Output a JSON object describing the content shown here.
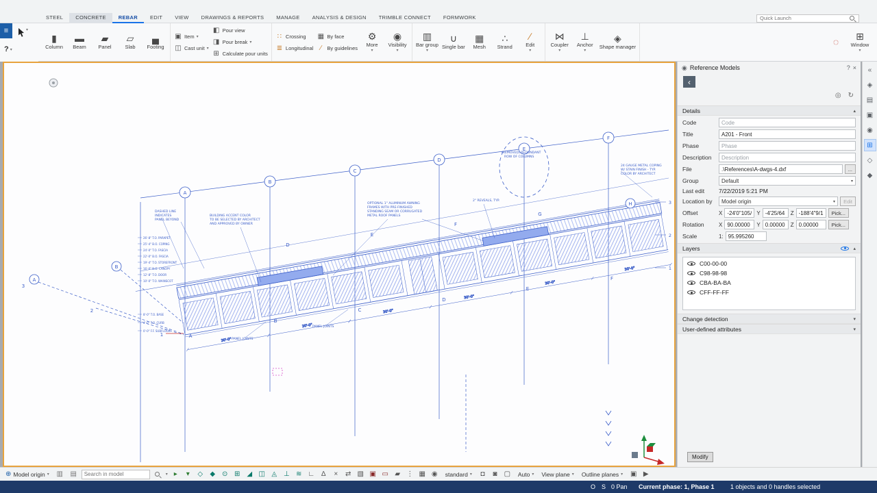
{
  "colors": {
    "accent": "#1a73e8",
    "viewport_border": "#e8a33d",
    "drawing_blue": "#3a5dc8",
    "status_bar_bg": "#1e3a68",
    "canopy_fill": "#93abee"
  },
  "titlebar": {
    "quick_launch_placeholder": "Quick Launch"
  },
  "tabs": [
    {
      "label": "STEEL"
    },
    {
      "label": "CONCRETE",
      "highlight": true
    },
    {
      "label": "REBAR",
      "active": true
    },
    {
      "label": "EDIT"
    },
    {
      "label": "VIEW"
    },
    {
      "label": "DRAWINGS & REPORTS"
    },
    {
      "label": "MANAGE"
    },
    {
      "label": "ANALYSIS & DESIGN"
    },
    {
      "label": "TRIMBLE CONNECT"
    },
    {
      "label": "FORMWORK"
    }
  ],
  "ribbon": {
    "column": "Column",
    "beam": "Beam",
    "panel": "Panel",
    "slab": "Slab",
    "footing": "Footing",
    "item": "Item",
    "cast_unit": "Cast unit",
    "pour_view": "Pour view",
    "pour_break": "Pour break",
    "calculate_pour_units": "Calculate pour units",
    "crossing": "Crossing",
    "longitudinal": "Longitudinal",
    "by_face": "By face",
    "by_guidelines": "By guidelines",
    "more": "More",
    "visibility": "Visibility",
    "bar_group": "Bar group",
    "single_bar": "Single bar",
    "mesh": "Mesh",
    "strand": "Strand",
    "edit": "Edit",
    "coupler": "Coupler",
    "anchor": "Anchor",
    "shape_manager": "Shape manager",
    "window": "Window"
  },
  "ribbon_icons": {
    "hamburger": "≡",
    "help": "?",
    "caret": "▾",
    "column": "▮",
    "beam": "▬",
    "panel": "▰",
    "slab": "▱",
    "footing": "▄",
    "item": "▣",
    "cast_unit": "◫",
    "pour_view": "◧",
    "pour_break": "◨",
    "calculate_pour_units": "⊞",
    "crossing": "∷",
    "longitudinal": "≣",
    "by_face": "▦",
    "by_guidelines": "∕",
    "more": "⚙",
    "visibility": "◉",
    "bar_group": "▥",
    "single_bar": "∪",
    "mesh": "▦",
    "strand": "∴",
    "edit": "∕",
    "coupler": "⋈",
    "anchor": "⊥",
    "shape_manager": "◈",
    "lasso": "◌",
    "window": "⊞",
    "panel_header": "◉",
    "back": "‹",
    "close": "×",
    "pin": "◎",
    "refresh": "↻",
    "globe": "⊕",
    "lock_a": "▥",
    "lock_b": "▤"
  },
  "side_panel": {
    "title": "Reference Models",
    "details_header": "Details",
    "fields": {
      "code_label": "Code",
      "code_placeholder": "Code",
      "title_label": "Title",
      "title_value": "A201 - Front",
      "phase_label": "Phase",
      "phase_placeholder": "Phase",
      "description_label": "Description",
      "description_placeholder": "Description",
      "file_label": "File",
      "file_value": ".\\References\\A-dwgs-4.dxf",
      "browse_label": "...",
      "group_label": "Group",
      "group_value": "Default",
      "last_edit_label": "Last edit",
      "last_edit_value": "7/22/2019 5:21 PM",
      "location_by_label": "Location by",
      "location_by_value": "Model origin",
      "edit_label": "Edit",
      "offset_label": "Offset",
      "x_label": "X",
      "y_label": "Y",
      "z_label": "Z",
      "offset_x": "-24'0\"105/",
      "offset_y": "-4'25/64",
      "offset_z": "-188'4\"9/1",
      "pick_label": "Pick...",
      "rotation_label": "Rotation",
      "rot_x": "90.00000",
      "rot_y": "0.00000",
      "rot_z": "0.00000",
      "scale_label": "Scale",
      "scale_prefix": "1:",
      "scale_value": "95.995260"
    },
    "layers_header": "Layers",
    "layers": [
      {
        "name": "C00-00-00"
      },
      {
        "name": "C98-98-98"
      },
      {
        "name": "CBA-BA-BA"
      },
      {
        "name": "CFF-FF-FF"
      }
    ],
    "change_detection_header": "Change detection",
    "uda_header": "User-defined attributes",
    "modify_label": "Modify"
  },
  "right_pane_icons": [
    {
      "name": "collapse-side-pane-icon",
      "glyph": "«"
    },
    {
      "name": "start-pane-icon",
      "glyph": "◈"
    },
    {
      "name": "properties-pane-icon",
      "glyph": "▤"
    },
    {
      "name": "applications-pane-icon",
      "glyph": "▣"
    },
    {
      "name": "components-pane-icon",
      "glyph": "◉"
    },
    {
      "name": "reference-models-pane-icon",
      "glyph": "⊞",
      "active": true
    },
    {
      "name": "shapes-catalog-pane-icon",
      "glyph": "◇"
    },
    {
      "name": "trimble-connect-pane-icon",
      "glyph": "◆"
    }
  ],
  "bottom_bar": {
    "origin_label": "Model origin",
    "search_placeholder": "Search in model",
    "standard_label": "standard",
    "auto_label": "Auto",
    "view_plane_label": "View plane",
    "outline_planes_label": "Outline planes",
    "icons_main": [
      {
        "name": "select-all-toggle-icon",
        "glyph": "▸",
        "color": "#2e7d32"
      },
      {
        "name": "select-filter-toggle-icon",
        "glyph": "▾",
        "color": "#2e7d32"
      },
      {
        "name": "snap-reference-points-icon",
        "glyph": "◇",
        "color": "#0b7a6a"
      },
      {
        "name": "snap-geometry-points-icon",
        "glyph": "◆",
        "color": "#0b7a6a"
      },
      {
        "name": "snap-nearest-point-icon",
        "glyph": "⊙",
        "color": "#0b7a6a"
      },
      {
        "name": "snap-any-position-icon",
        "glyph": "⊞",
        "color": "#0b7a6a"
      },
      {
        "name": "snap-endpoint-icon",
        "glyph": "◢",
        "color": "#0b7a6a"
      },
      {
        "name": "snap-midpoint-icon",
        "glyph": "◫",
        "color": "#0b7a6a"
      },
      {
        "name": "snap-intersection-icon",
        "glyph": "◬",
        "color": "#0b7a6a"
      },
      {
        "name": "snap-perpendicular-icon",
        "glyph": "⊥",
        "color": "#0b7a6a"
      },
      {
        "name": "snap-extension-icon",
        "glyph": "≋",
        "color": "#0b7a6a"
      },
      {
        "name": "ortho-toggle-icon",
        "glyph": "∟",
        "color": "#555555"
      },
      {
        "name": "relative-input-icon",
        "glyph": "∆",
        "color": "#555555"
      },
      {
        "name": "numeric-snap-icon",
        "glyph": "×",
        "color": "#555555"
      },
      {
        "name": "drag-and-drop-icon",
        "glyph": "⇄",
        "color": "#555555"
      },
      {
        "name": "smart-select-icon",
        "glyph": "▧",
        "color": "#555555"
      },
      {
        "name": "select-components-icon",
        "glyph": "▣",
        "color": "#8a2b2b"
      },
      {
        "name": "select-parts-icon",
        "glyph": "▭",
        "color": "#8a2b2b"
      },
      {
        "name": "select-surfaces-icon",
        "glyph": "▰",
        "color": "#555555"
      },
      {
        "name": "select-points-icon",
        "glyph": "⋮",
        "color": "#555555"
      },
      {
        "name": "select-grids-icon",
        "glyph": "▦",
        "color": "#555555"
      },
      {
        "name": "select-welds-icon",
        "glyph": "◉",
        "color": "#555555"
      }
    ],
    "icons_secondary": [
      {
        "name": "select-objects-in-components-icon",
        "glyph": "◘",
        "color": "#555555"
      },
      {
        "name": "select-objects-in-assemblies-icon",
        "glyph": "◙",
        "color": "#555555"
      },
      {
        "name": "view-projection-icon",
        "glyph": "▢",
        "color": "#555555"
      }
    ],
    "icons_end": [
      {
        "name": "create-view-icon",
        "glyph": "▣",
        "color": "#555555"
      },
      {
        "name": "fly-mode-icon",
        "glyph": "▶",
        "color": "#555555"
      }
    ]
  },
  "status_bar": {
    "osnap1": "O",
    "osnap2": "S",
    "pan": "0 Pan",
    "phase": "Current phase: 1, Phase 1",
    "selection": "1 objects and 0 handles selected"
  },
  "drawing": {
    "top_grid": [
      "A",
      "B",
      "C",
      "D",
      "E",
      "F"
    ],
    "h_bubble": "H",
    "right_edge": [
      "3",
      "2",
      "1"
    ],
    "left_bubble_a": "A",
    "left_bubble_b": "B",
    "left_marks": {
      "m3": "3",
      "m2": "2",
      "m1": "1"
    },
    "red_a": "A",
    "upper_letters": [
      "D",
      "E",
      "F",
      "G"
    ],
    "lower_letters": [
      "B",
      "C",
      "D",
      "E",
      "F"
    ],
    "dims": [
      "30'-0\"",
      "30'-0\"",
      "30'-0\"",
      "30'-0\"",
      "30'-0\"",
      "30'-0\""
    ],
    "annotations": [
      "DASHED LINE",
      "INDICATES",
      "PANEL BEYOND",
      "BUILDING ACCENT COLOR",
      "TO BE SELECTED BY ARCHITECT",
      "AND APPROVED BY OWNER",
      "OPTIONAL 1\" ALUMINUM AWNING",
      "FRAMES WITH PRE-FINISHED",
      "STANDING SEAM OR CORRUGATED",
      "METAL ROOF PANELS",
      "2\" REVEALS, TYP.",
      "(REMOVED) REDUNDANT",
      "ROW OF COLUMNS",
      "24 GAUGE METAL COPING",
      "W/ STAIN FINISH - TYP.",
      "COLOR BY ARCHITECT",
      "PANEL JOINTS",
      "PANEL JOINTS"
    ],
    "levels_upper": [
      "26'-8\" T.O. PARAPET",
      "25'-4\" B.O. COPING",
      "24'-0\" T.O. FASCIA",
      "22'-0\" B.O. FASCIA",
      "19'-4\" T.O. STOREFRONT",
      "16'-0\" B.O. CANOPY",
      "12'-8\" T.O. DOOR",
      "10'-0\" T.O. WAINSCOT"
    ],
    "levels_lower": [
      "8'-0\" T.O. BASE",
      "4'-0\" T.O. CURB",
      "0'-0\" F.F. SUBFLOOR"
    ]
  }
}
